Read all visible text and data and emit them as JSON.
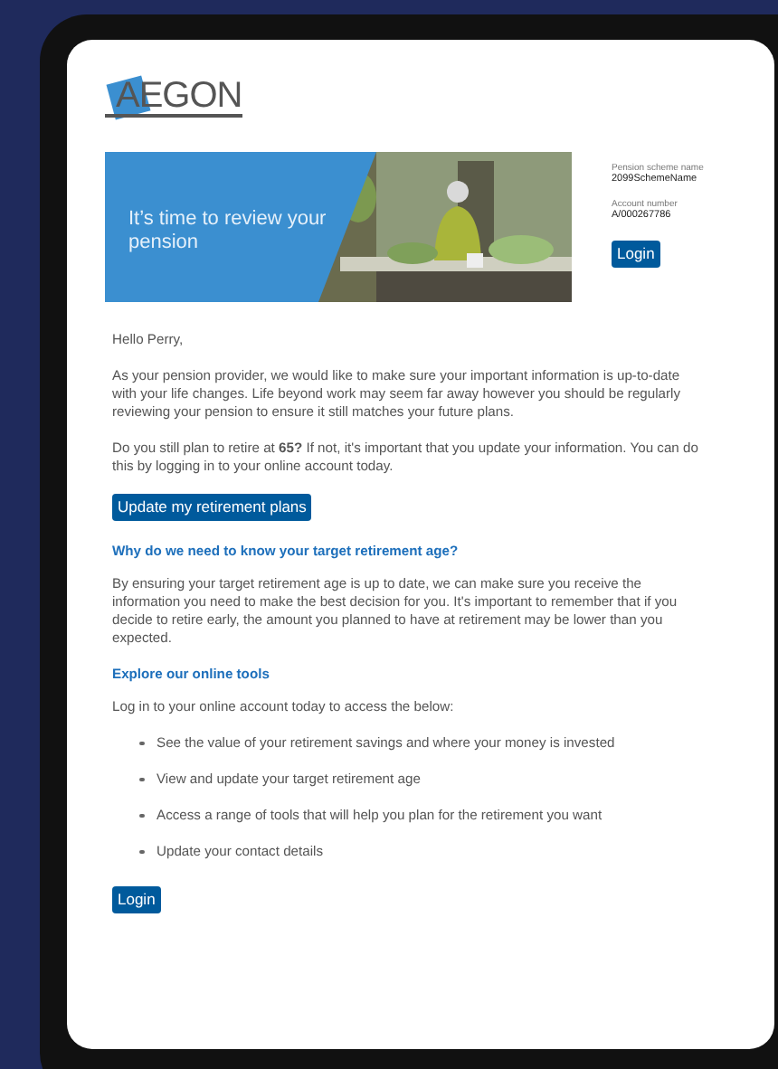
{
  "logo": {
    "text": "AEGON"
  },
  "banner": {
    "kind": "picture",
    "headline": "It’s time to review your pension"
  },
  "account_info": [
    {
      "label": "Pension scheme name",
      "value": "2099SchemeName"
    },
    {
      "label": "Account number",
      "value": "A/000267786"
    }
  ],
  "top_button": "Login",
  "greeting": "Hello Perry,",
  "paragraphs": [
    "As your pension provider, we would like to make sure your important information is up-to-date with your life changes. Life beyond work may seem far away however you should be regularly reviewing your pension to ensure it still matches your future plans.",
    "Do you still plan to retire at **65?** If not, it's important that you update your information. You can do this by logging in to your online account today."
  ],
  "cta_button": "Update my retirement plans",
  "section_1": {
    "heading": "Why do we need to know your target retirement age?",
    "text": "By ensuring your target retirement age is up to date, we can make sure you receive the information you need to make the best decision for you. It's important to remember that if you decide to retire early, the amount you planned to have at retirement may be lower than you expected."
  },
  "section_2": {
    "heading": "Explore our online tools",
    "intro": "Log in to your online account today to access the below:",
    "bullets": [
      "See the value of your retirement savings and where your money is invested",
      "View and update your target retirement age",
      "Access a range of tools that will help you plan for the retirement you want",
      "Update your contact details"
    ]
  },
  "bottom_button": "Login"
}
